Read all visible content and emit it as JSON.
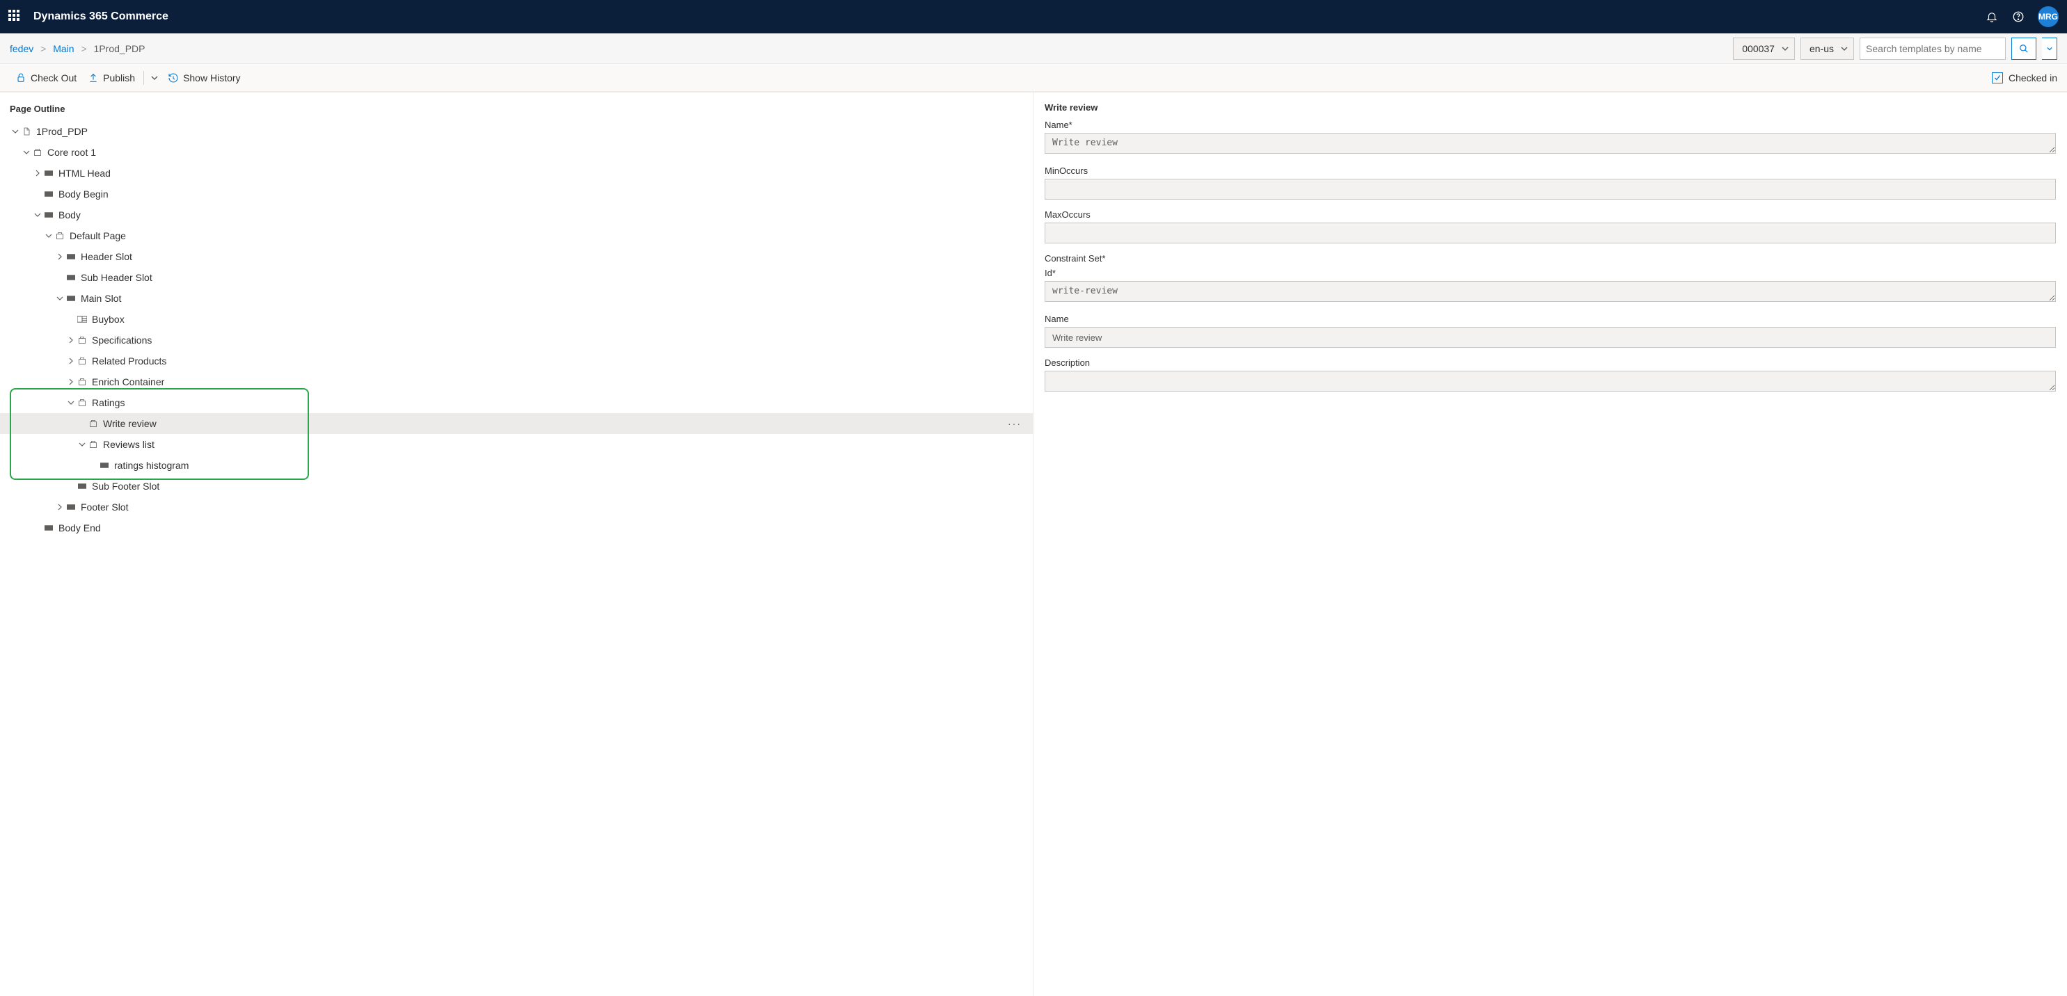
{
  "header": {
    "app_title": "Dynamics 365 Commerce",
    "avatar_initials": "MRG"
  },
  "breadcrumb": {
    "items": [
      "fedev",
      "Main",
      "1Prod_PDP"
    ],
    "channel": "000037",
    "locale": "en-us",
    "search_placeholder": "Search templates by name"
  },
  "commands": {
    "checkout": "Check Out",
    "publish": "Publish",
    "history": "Show History",
    "status": "Checked in"
  },
  "outline": {
    "title": "Page Outline",
    "nodes": {
      "root": "1Prod_PDP",
      "core_root": "Core root 1",
      "html_head": "HTML Head",
      "body_begin": "Body Begin",
      "body": "Body",
      "default_page": "Default Page",
      "header_slot": "Header Slot",
      "sub_header_slot": "Sub Header Slot",
      "main_slot": "Main Slot",
      "buybox": "Buybox",
      "specifications": "Specifications",
      "related_products": "Related Products",
      "enrich_container": "Enrich Container",
      "ratings": "Ratings",
      "write_review": "Write review",
      "reviews_list": "Reviews list",
      "ratings_histogram": "ratings histogram",
      "sub_footer_slot": "Sub Footer Slot",
      "footer_slot": "Footer Slot",
      "body_end": "Body End"
    }
  },
  "panel": {
    "title": "Write review",
    "name_label": "Name*",
    "name_value": "Write review",
    "minoccurs_label": "MinOccurs",
    "minoccurs_value": "",
    "maxoccurs_label": "MaxOccurs",
    "maxoccurs_value": "",
    "constraint_set_label": "Constraint Set*",
    "id_label": "Id*",
    "id_value": "write-review",
    "cs_name_label": "Name",
    "cs_name_value": "Write review",
    "description_label": "Description",
    "description_value": ""
  }
}
